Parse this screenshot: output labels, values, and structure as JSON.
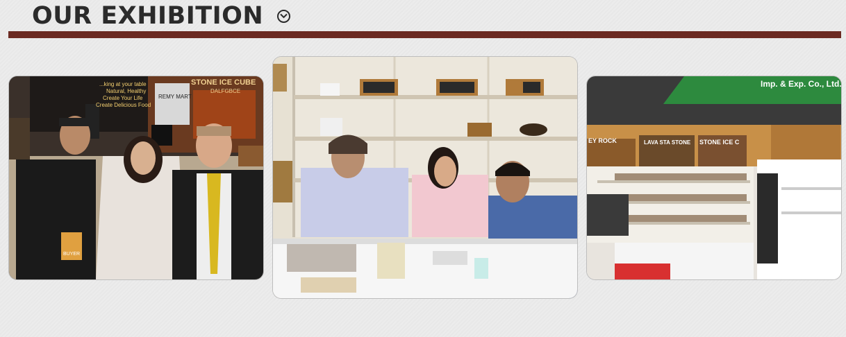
{
  "section": {
    "title": "OUR EXHIBITION",
    "toggle_icon": "chevron-down-circle-icon",
    "rule_color": "#6b2a22"
  },
  "photos": [
    {
      "booth_text_line1": "...king at your table",
      "booth_text_line2": "Natural, Healthy",
      "booth_text_line3": "Create Your Life",
      "booth_text_line4": "Create Delicious Food",
      "brand": "REMY MART",
      "sign": "STONE ICE CUBE",
      "sign_sub": "DALFGBCE",
      "badge": "BUYER"
    },
    {},
    {
      "banner": "Imp. & Exp. Co., Ltd.",
      "panel1": "EY ROCK",
      "panel2": "LAVA STA STONE",
      "panel3": "STONE ICE C"
    }
  ]
}
